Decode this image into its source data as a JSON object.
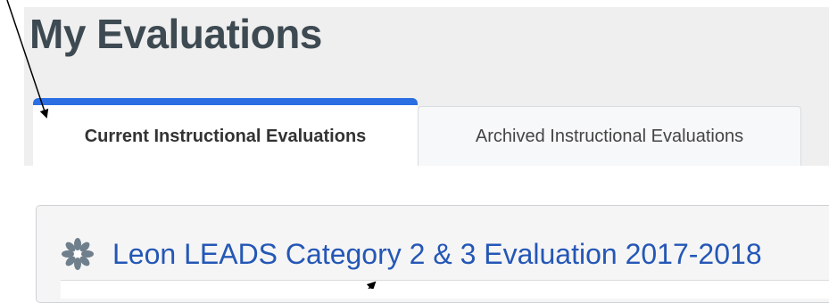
{
  "page": {
    "title": "My Evaluations"
  },
  "tabs": [
    {
      "label": "Current Instructional Evaluations",
      "active": true
    },
    {
      "label": "Archived Instructional Evaluations",
      "active": false
    }
  ],
  "evaluations": [
    {
      "title": "Leon LEADS Category 2 & 3 Evaluation 2017-2018",
      "icon": "asterisk-flower-icon"
    }
  ],
  "colors": {
    "active_tab_accent": "#2b6fe3",
    "link": "#2457b6",
    "title": "#3e4a52",
    "page_background": "#efefef"
  }
}
